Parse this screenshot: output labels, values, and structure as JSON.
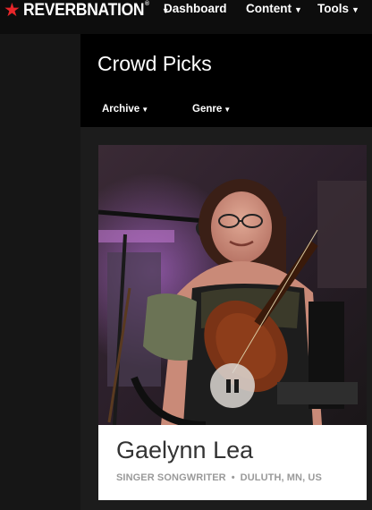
{
  "brand": {
    "name": "REVERBNATION",
    "trademark": "®",
    "accent_color": "#e8262a"
  },
  "nav": {
    "items": [
      {
        "label": "Dashboard",
        "has_dropdown": false
      },
      {
        "label": "Content",
        "has_dropdown": true
      },
      {
        "label": "Tools",
        "has_dropdown": true
      }
    ]
  },
  "page": {
    "title": "Crowd Picks",
    "filters": [
      {
        "label": "Archive"
      },
      {
        "label": "Genre"
      }
    ]
  },
  "artist_card": {
    "name": "Gaelynn Lea",
    "genre": "SINGER SONGWRITER",
    "separator": "•",
    "location": "DULUTH, MN, US",
    "player_state": "playing",
    "control_icon": "pause-icon"
  }
}
